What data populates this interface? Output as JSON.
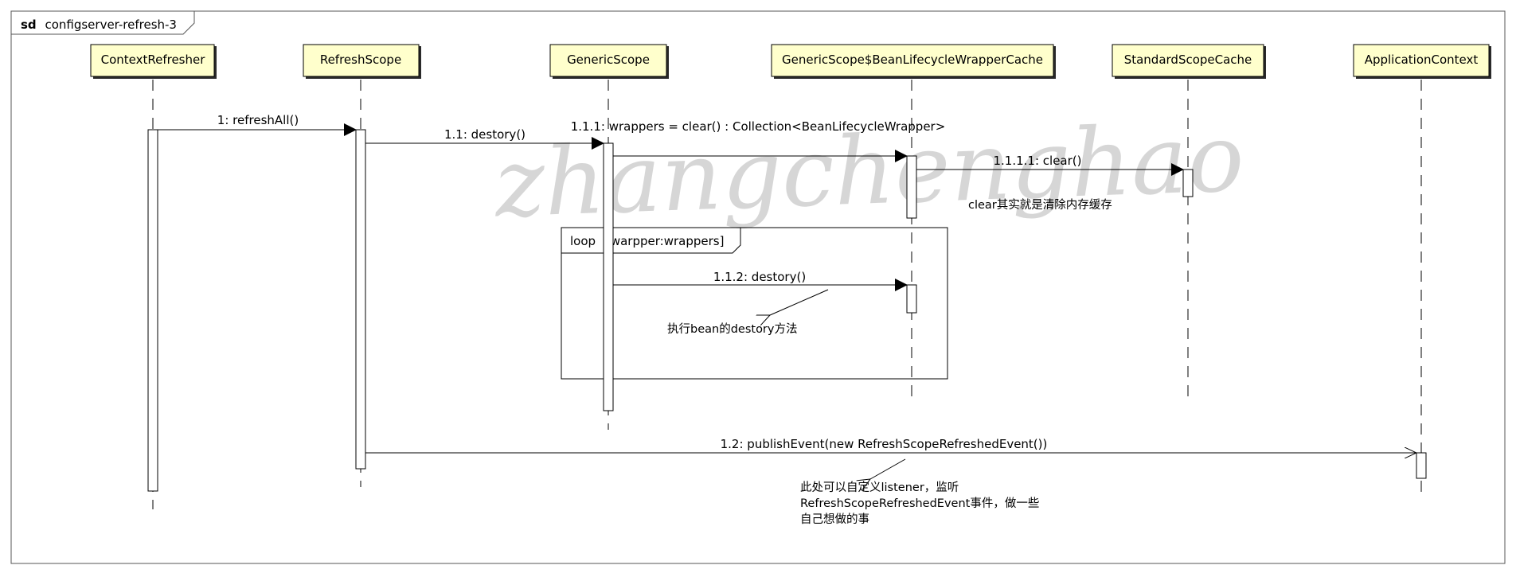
{
  "frame": {
    "kind": "sd",
    "name": "configserver-refresh-3"
  },
  "watermark": "zhangchenghao",
  "lifelines": [
    {
      "id": "ll1",
      "name": "ContextRefresher"
    },
    {
      "id": "ll2",
      "name": "RefreshScope"
    },
    {
      "id": "ll3",
      "name": "GenericScope"
    },
    {
      "id": "ll4",
      "name": "GenericScope$BeanLifecycleWrapperCache"
    },
    {
      "id": "ll5",
      "name": "StandardScopeCache"
    },
    {
      "id": "ll6",
      "name": "ApplicationContext"
    }
  ],
  "messages": [
    {
      "label": "1: refreshAll()",
      "from": "ContextRefresher",
      "to": "RefreshScope"
    },
    {
      "label": "1.1: destory()",
      "from": "RefreshScope",
      "to": "GenericScope"
    },
    {
      "label": "1.1.1: wrappers = clear() : Collection<BeanLifecycleWrapper>",
      "from": "GenericScope",
      "to": "GenericScope$BeanLifecycleWrapperCache"
    },
    {
      "label": "1.1.1.1: clear()",
      "from": "GenericScope$BeanLifecycleWrapperCache",
      "to": "StandardScopeCache"
    },
    {
      "label": "1.1.2: destory()",
      "from": "GenericScope",
      "to": "GenericScope$BeanLifecycleWrapperCache"
    },
    {
      "label": "1.2: publishEvent(new RefreshScopeRefreshedEvent())",
      "from": "RefreshScope",
      "to": "ApplicationContext"
    }
  ],
  "loop": {
    "operator": "loop",
    "guard": "[warpper:wrappers]"
  },
  "notes": [
    {
      "lines": [
        "clear其实就是清除内存缓存"
      ]
    },
    {
      "lines": [
        "执行bean的destory方法"
      ]
    },
    {
      "lines": [
        "此处可以自定义listener，监听",
        "RefreshScopeRefreshedEvent事件，做一些",
        "自己想做的事"
      ]
    }
  ],
  "colors": {
    "lifeline_fill": "#ffffcc",
    "lifeline_border": "#000000",
    "watermark": "#d0d0d0"
  }
}
